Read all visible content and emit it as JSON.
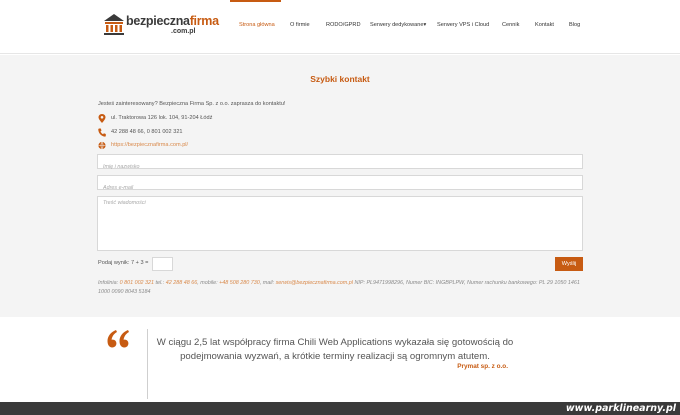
{
  "header": {
    "logo_main": "bezpieczna",
    "logo_accent": "firma",
    "logo_sub": ".com.pl",
    "nav": [
      {
        "label": "Strona główna",
        "active": true
      },
      {
        "label": "O firmie",
        "active": false
      },
      {
        "label": "RODO/GPRD",
        "active": false
      },
      {
        "label": "Serwery dedykowane",
        "active": false,
        "dropdown": true
      },
      {
        "label": "Serwery VPS i Cloud",
        "active": false
      },
      {
        "label": "Cennik",
        "active": false
      },
      {
        "label": "Kontakt",
        "active": false
      },
      {
        "label": "Blog",
        "active": false
      }
    ],
    "dropdown_glyph": "▾"
  },
  "contact": {
    "title": "Szybki kontakt",
    "intro": "Jesteś zainteresowany? Bezpieczna Firma Sp. z o.o. zaprasza do kontaktu!",
    "address": "ul. Traktorowa 126 lok. 104, 91-204 Łódź",
    "phones": "42 288 48 66, 0 801 002 321",
    "website": "https://bezpiecznafirma.com.pl/",
    "name_placeholder": "Imię i nazwisko",
    "email_placeholder": "Adres e-mail",
    "message_placeholder": "Treść wiadomości",
    "captcha_label": "Podaj wynik: 7 + 3 =",
    "send_label": "Wyślij",
    "footer": {
      "infolinia_label": "Infolinia: ",
      "infolinia": "0 801 002 321",
      "tel_label": " tel.: ",
      "tel": "42 288 48 66",
      "mobile_label": ", mobile: ",
      "mobile": "+48 508 280 730",
      "mail_label": ", mail: ",
      "mail": "serwis@bezpiecznafirma.com.pl",
      "rest": " NIP: PL9471998296, Numer BIC: INGBPLPW, Numer rachunku bankowego: PL 29 1050 1461 1000 0090 8043 5184"
    }
  },
  "testimonial": {
    "text": "W ciągu 2,5 lat współpracy firma Chili Web Applications wykazała się gotowością do podejmowania wyzwań, a krótkie terminy realizacji są ogromnym atutem.",
    "author": "Prymat sp. z o.o."
  },
  "watermark": "www.parklinearny.pl",
  "colors": {
    "accent": "#c75b12",
    "background_section": "#f4f4f4",
    "bottom_bar": "#3a3a3a"
  }
}
